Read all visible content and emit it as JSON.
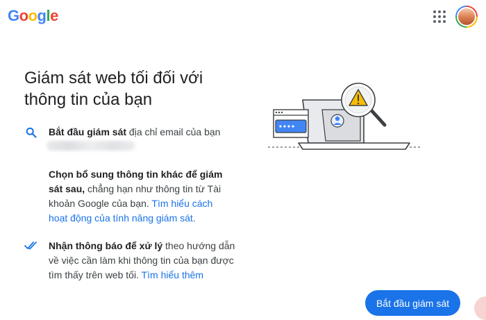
{
  "header": {
    "logo_letters": [
      {
        "ch": "G",
        "color": "#4285f4"
      },
      {
        "ch": "o",
        "color": "#ea4335"
      },
      {
        "ch": "o",
        "color": "#fbbc04"
      },
      {
        "ch": "g",
        "color": "#4285f4"
      },
      {
        "ch": "l",
        "color": "#34a853"
      },
      {
        "ch": "e",
        "color": "#ea4335"
      }
    ],
    "apps_icon": "google-apps-grid",
    "avatar_icon": "account-avatar"
  },
  "main": {
    "title": "Giám sát web tối đối với thông tin của bạn",
    "step1": {
      "bold": "Bắt đầu giám sát",
      "text": " địa chỉ email của bạn",
      "icon": "search-icon"
    },
    "step2": {
      "bold": "Chọn bổ sung thông tin khác để giám sát sau,",
      "text": " chẳng hạn như thông tin từ Tài khoản Google của bạn. ",
      "link": "Tìm hiểu cách hoạt động của tính năng giám sát."
    },
    "step3": {
      "bold": "Nhận thông báo để xử lý",
      "text": " theo hướng dẫn về việc cần làm khi thông tin của bạn được tìm thấy trên web tối. ",
      "link": "Tìm hiểu thêm",
      "icon": "double-check-icon"
    },
    "cta_label": "Bắt đầu giám sát"
  },
  "colors": {
    "accent": "#1a73e8",
    "warning": "#fbbc04",
    "text": "#202124"
  }
}
